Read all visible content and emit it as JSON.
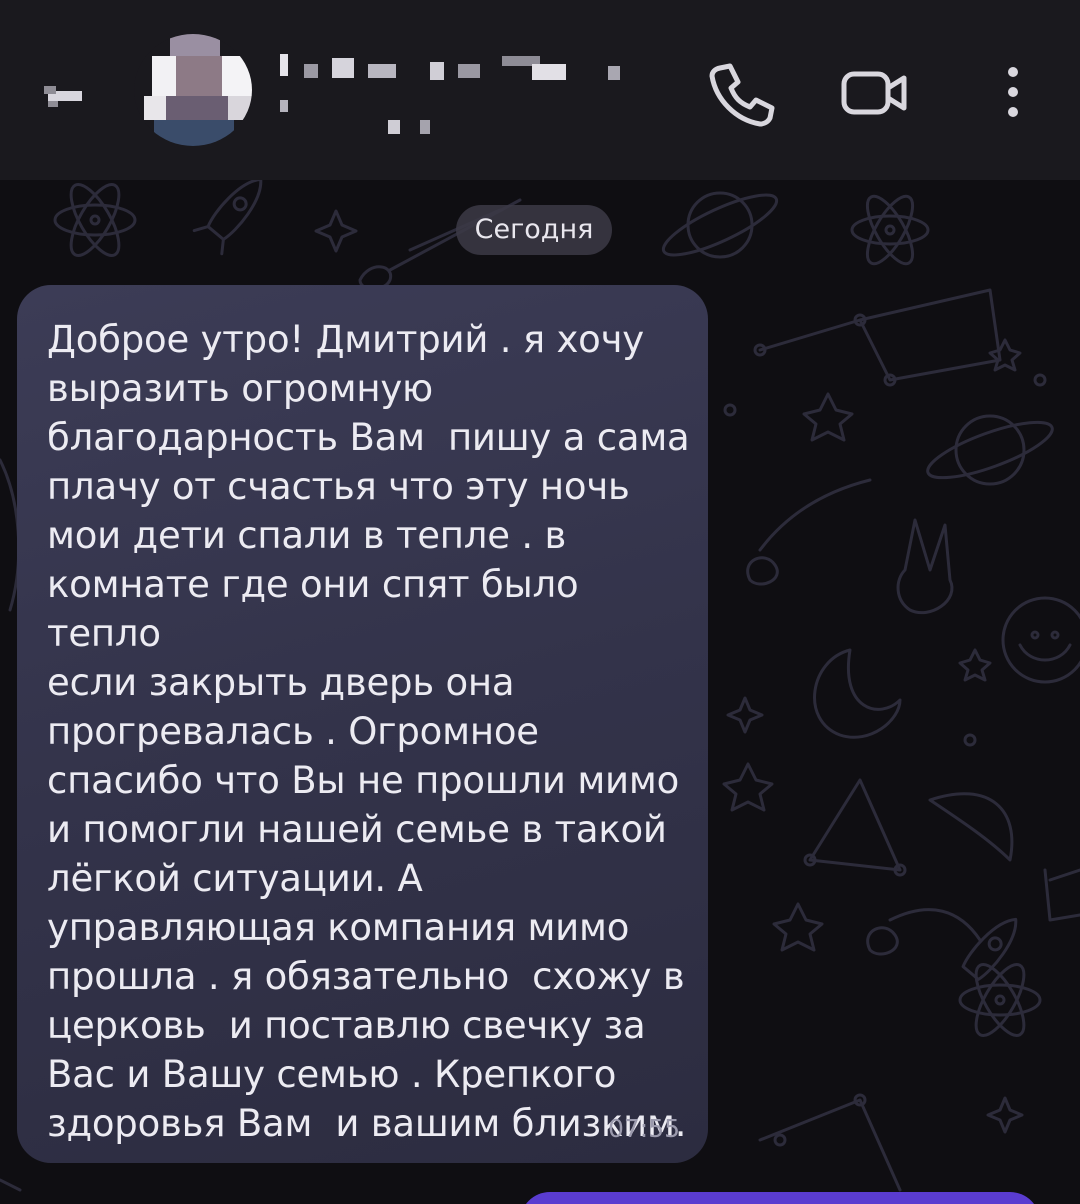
{
  "header": {
    "back_icon": "back-arrow-icon",
    "avatar_icon": "contact-avatar-blurred",
    "name_icon": "contact-name-blurred",
    "call_icon": "phone-icon",
    "video_icon": "video-camera-icon",
    "menu_icon": "more-vert-icon"
  },
  "chat": {
    "date_label": "Сегодня",
    "messages": [
      {
        "text": "Доброе утро! Дмитрий . я хочу\nвыразить огромную\nблагодарность Вам  пишу а сама\nплачу от счастья что эту ночь\nмои дети спали в тепле . в\nкомнате где они спят было тепло\nесли закрыть дверь она\nпрогревалась . Огромное\nспасибо что Вы не прошли мимо\nи помогли нашей семье в такой\nлёгкой ситуации. А\nуправляющая компания мимо\nпрошла . я обязательно  схожу в\nцерковь  и поставлю свечку за\nВас и Вашу семью . Крепкого\nздоровья Вам  и вашим близким.",
        "time": "07:55",
        "direction": "incoming"
      }
    ]
  },
  "colors": {
    "header_bg": "#1a191e",
    "chat_bg": "#0f0e12",
    "bubble_in": "#35354d",
    "bubble_out": "#5a3cd0",
    "doodle": "#2c2b3a"
  }
}
